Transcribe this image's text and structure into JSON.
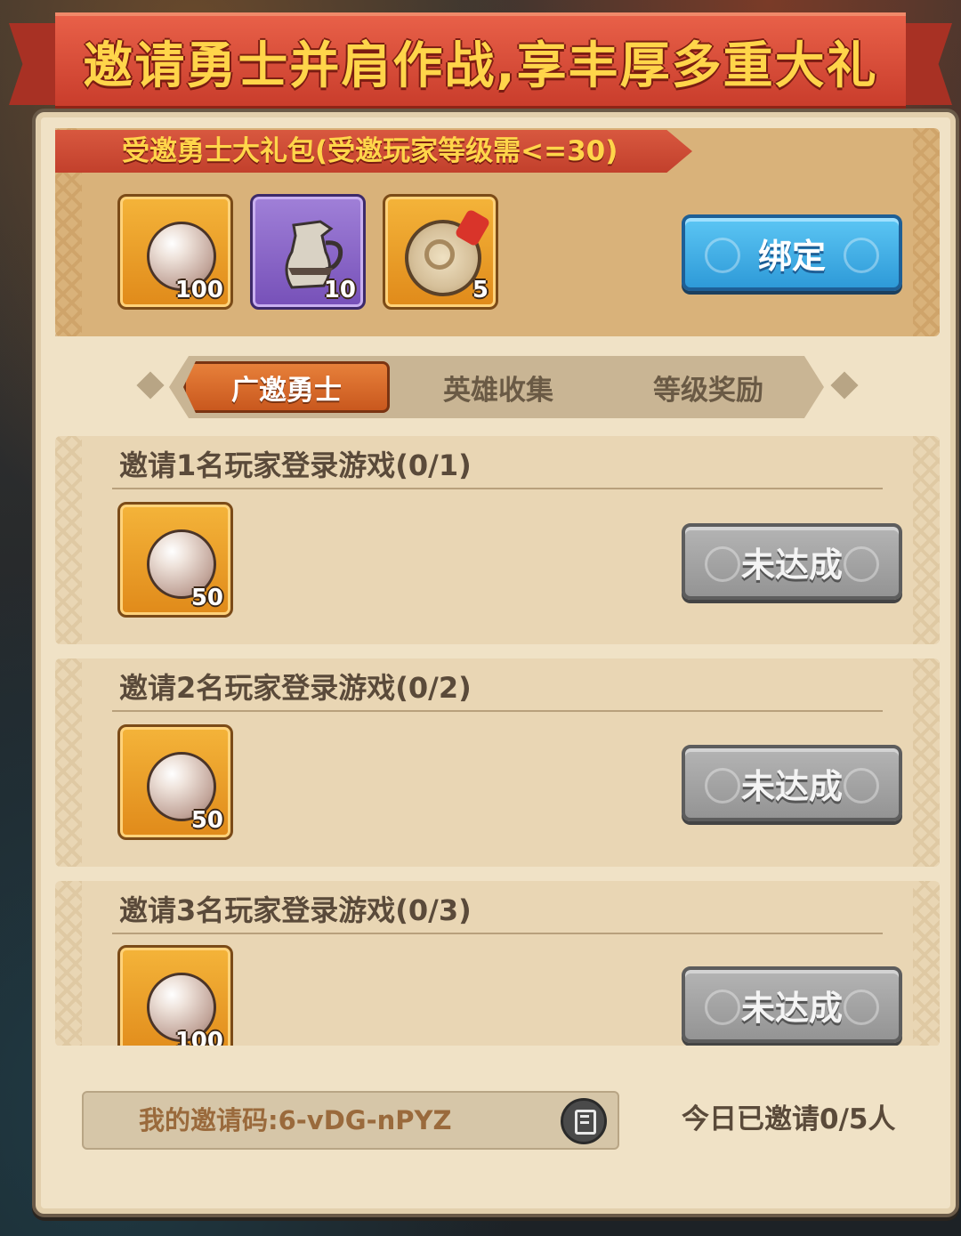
{
  "header": {
    "title": "邀请勇士并肩作战,享丰厚多重大礼"
  },
  "gift": {
    "banner": "受邀勇士大礼包(受邀玩家等级需<=30)",
    "items": [
      {
        "icon": "pearl-icon",
        "qty": "100"
      },
      {
        "icon": "jug-icon",
        "qty": "10"
      },
      {
        "icon": "drumstick-plate-icon",
        "qty": "5"
      }
    ],
    "bind_button": "绑定"
  },
  "tabs": [
    {
      "label": "广邀勇士",
      "active": true
    },
    {
      "label": "英雄收集",
      "active": false
    },
    {
      "label": "等级奖励",
      "active": false
    }
  ],
  "tasks": [
    {
      "title": "邀请1名玩家登录游戏(0/1)",
      "reward_icon": "pearl-icon",
      "reward_qty": "50",
      "button": "未达成"
    },
    {
      "title": "邀请2名玩家登录游戏(0/2)",
      "reward_icon": "pearl-icon",
      "reward_qty": "50",
      "button": "未达成"
    },
    {
      "title": "邀请3名玩家登录游戏(0/3)",
      "reward_icon": "pearl-icon",
      "reward_qty": "100",
      "button": "未达成"
    }
  ],
  "footer": {
    "invite_code_label": "我的邀请码:6-vDG-nPYZ",
    "today_invited": "今日已邀请0/5人"
  },
  "colors": {
    "accent_red": "#c93d2c",
    "title_gold": "#ffd54a",
    "button_blue": "#2e9ad8",
    "button_gray": "#949494"
  }
}
